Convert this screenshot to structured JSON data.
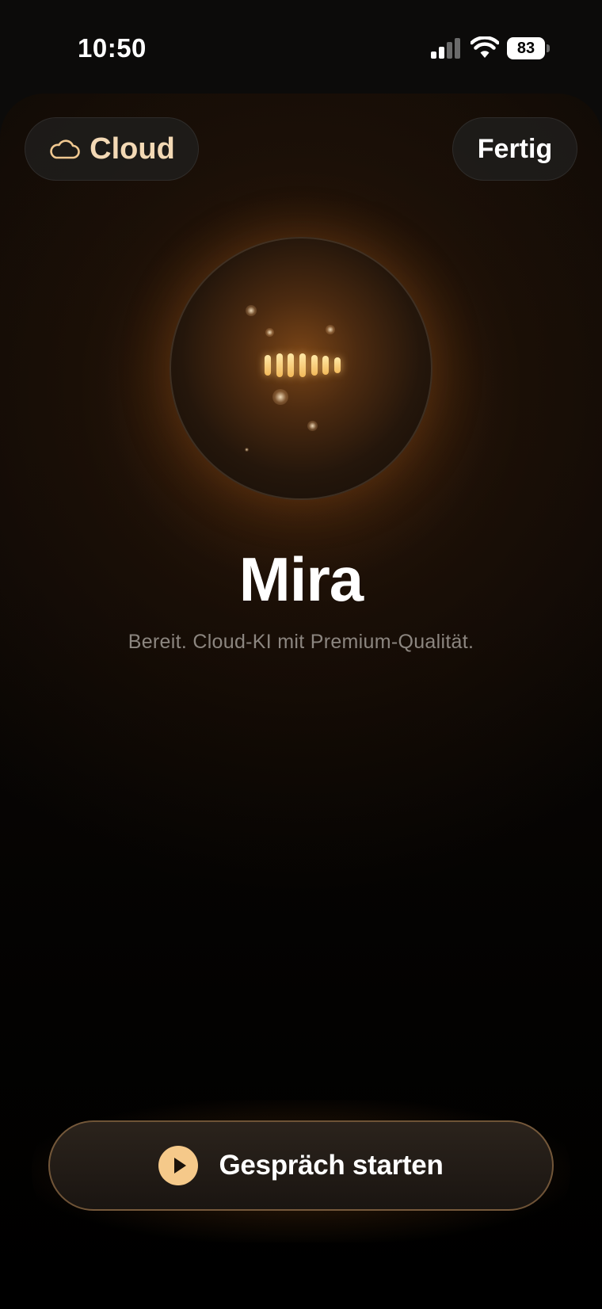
{
  "status_bar": {
    "time": "10:50",
    "battery": "83",
    "icons": [
      "signal-icon",
      "wifi-icon",
      "battery-icon"
    ]
  },
  "header": {
    "mode_label": "Cloud",
    "mode_icon": "cloud-icon",
    "done_label": "Fertig"
  },
  "assistant": {
    "name": "Mira",
    "status": "Bereit. Cloud-KI mit Premium-Qualität."
  },
  "start_button": {
    "label": "Gespräch starten",
    "icon": "play-icon"
  },
  "colors": {
    "accent": "#f5c98a",
    "mode_text": "#f3d9b5",
    "secondary_text": "#8c8680"
  }
}
